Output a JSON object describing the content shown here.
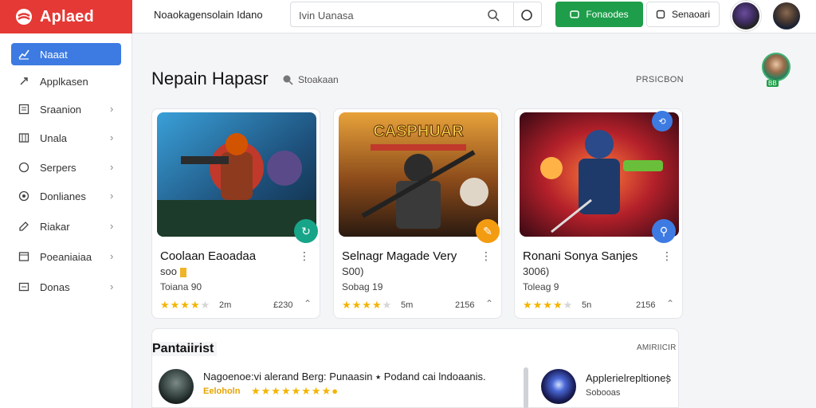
{
  "header": {
    "brand": "Aplaed",
    "app_name": "Noaokagensolain Idano",
    "search_placeholder": "Ivin Uanasa",
    "primary_button": "Fonaodes",
    "secondary_button": "Senaoari"
  },
  "sidebar": {
    "items": [
      {
        "label": "Naaat",
        "icon": "chart-icon",
        "active": true
      },
      {
        "label": "Applkasen",
        "icon": "rocket-icon"
      },
      {
        "label": "Sraanion",
        "icon": "list-icon"
      },
      {
        "label": "Unala",
        "icon": "grid-icon"
      },
      {
        "label": "Serpers",
        "icon": "shield-icon"
      },
      {
        "label": "Donlianes",
        "icon": "target-icon"
      },
      {
        "label": "Riakar",
        "icon": "edit-icon"
      },
      {
        "label": "Poeaniaiaa",
        "icon": "panel-icon"
      },
      {
        "label": "Donas",
        "icon": "folder-icon"
      }
    ]
  },
  "section": {
    "title": "Nepain Hapasr",
    "subtitle": "Stoakaan",
    "link": "PRSICBON",
    "profile_badge": "BB"
  },
  "cards": [
    {
      "title": "Coolaan Eaoadaa",
      "line2": "soo",
      "line3": "Toiana 90",
      "downloads": "2m",
      "count": "£230",
      "rating": 4,
      "accent": "#17a589"
    },
    {
      "title": "Selnagr Magade Very",
      "line2": "S00)",
      "line3": "Sobag 19",
      "downloads": "5m",
      "count": "2156",
      "rating": 4,
      "accent": "#f39c12",
      "art_text": "CASPHUAR"
    },
    {
      "title": "Ronani Sonya Sanjes",
      "line2": "3006)",
      "line3": "Toleag 9",
      "downloads": "5n",
      "count": "2156",
      "rating": 4,
      "accent": "#3d7be2"
    }
  ],
  "panel": {
    "title": "Pantaiirist",
    "link": "AMIRIICIR",
    "item1": {
      "title": "Nagoenoe:vi alerand Berg:  Punaasin  ⭑ Podand cai lndoaanis.",
      "sub": "Eeloholn",
      "rating": 8
    },
    "item2": {
      "title": "Applerielrepltiones",
      "sub": "Sobooas"
    }
  },
  "colors": {
    "brand_red": "#e53935",
    "active_blue": "#3d7be2",
    "green": "#1e9e4a",
    "star": "#f4b400"
  }
}
